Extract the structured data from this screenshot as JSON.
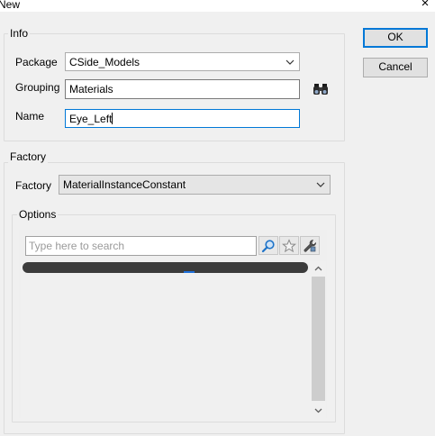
{
  "window": {
    "title": "New",
    "close_glyph": "×"
  },
  "buttons": {
    "ok_label": "OK",
    "cancel_label": "Cancel"
  },
  "info": {
    "legend": "Info",
    "package_label": "Package",
    "package_value": "CSide_Models",
    "grouping_label": "Grouping",
    "grouping_value": "Materials",
    "name_label": "Name",
    "name_value": "Eye_Left"
  },
  "factory": {
    "legend": "Factory",
    "factory_label": "Factory",
    "factory_value": "MaterialInstanceConstant"
  },
  "options": {
    "legend": "Options",
    "search_placeholder": "Type here to search",
    "search_value": ""
  },
  "icons": {
    "browse": "binoculars-icon",
    "search": "magnifier-icon",
    "favorite": "star-icon",
    "tools": "wrench-icon",
    "dropdown": "chevron-down-icon",
    "scroll_up": "chevron-up-icon",
    "scroll_down": "chevron-down-icon"
  },
  "colors": {
    "focus": "#0078d7",
    "background": "#f0f0f0",
    "redaction": "#3c3c3c"
  }
}
